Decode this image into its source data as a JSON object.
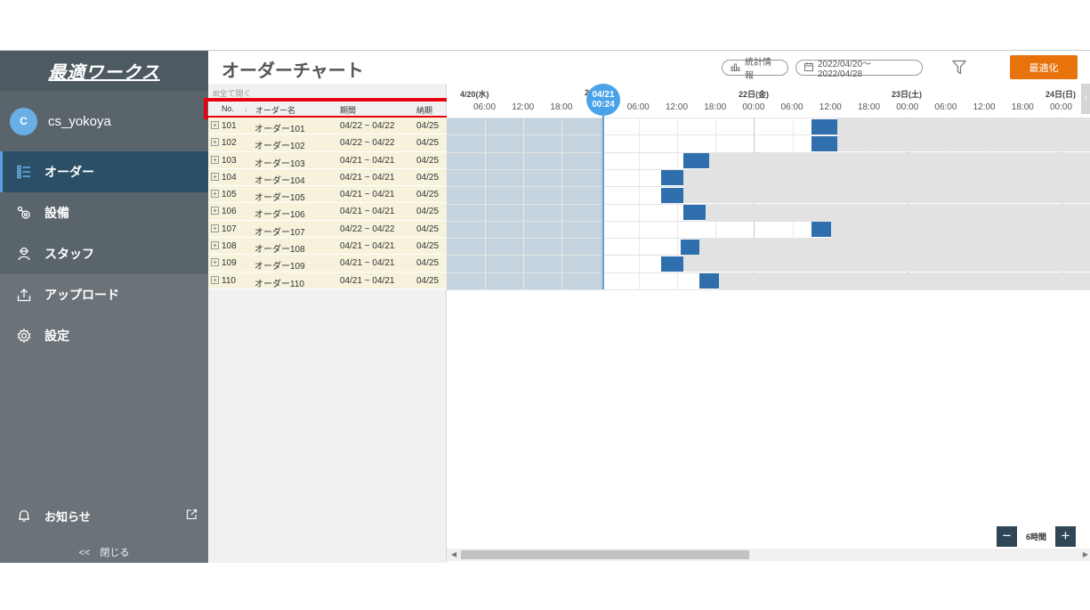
{
  "sidebar": {
    "logo": "最適ワークス",
    "user": {
      "initial": "C",
      "name": "cs_yokoya"
    },
    "nav": [
      {
        "icon": "list-icon",
        "label": "オーダー"
      },
      {
        "icon": "equipment-gear-icon",
        "label": "設備"
      },
      {
        "icon": "staff-person-icon",
        "label": "スタッフ"
      },
      {
        "icon": "upload-icon",
        "label": "アップロード"
      },
      {
        "icon": "settings-gear-icon",
        "label": "設定"
      }
    ],
    "notice": "お知らせ",
    "collapse": "<<　閉じる"
  },
  "header": {
    "title": "オーダーチャート",
    "stats_label": "統計情報",
    "date_range": "2022/04/20〜2022/04/28",
    "optimize_label": "最適化"
  },
  "orders": {
    "expand_all": "全て開く",
    "columns": {
      "no": "No.",
      "sort_arrow": "↓",
      "name": "オーダー名",
      "period": "期間",
      "due": "納期"
    },
    "rows": [
      {
        "no": "101",
        "name": "オーダー101",
        "period": "04/22 ~ 04/22",
        "due": "04/25"
      },
      {
        "no": "102",
        "name": "オーダー102",
        "period": "04/22 ~ 04/22",
        "due": "04/25"
      },
      {
        "no": "103",
        "name": "オーダー103",
        "period": "04/21 ~ 04/21",
        "due": "04/25"
      },
      {
        "no": "104",
        "name": "オーダー104",
        "period": "04/21 ~ 04/21",
        "due": "04/25"
      },
      {
        "no": "105",
        "name": "オーダー105",
        "period": "04/21 ~ 04/21",
        "due": "04/25"
      },
      {
        "no": "106",
        "name": "オーダー106",
        "period": "04/21 ~ 04/21",
        "due": "04/25"
      },
      {
        "no": "107",
        "name": "オーダー107",
        "period": "04/22 ~ 04/22",
        "due": "04/25"
      },
      {
        "no": "108",
        "name": "オーダー108",
        "period": "04/21 ~ 04/21",
        "due": "04/25"
      },
      {
        "no": "109",
        "name": "オーダー109",
        "period": "04/21 ~ 04/21",
        "due": "04/25"
      },
      {
        "no": "110",
        "name": "オーダー110",
        "period": "04/21 ~ 04/21",
        "due": "04/25"
      }
    ]
  },
  "gantt": {
    "days": [
      "4/20(水)",
      "2",
      "22日(金)",
      "23日(土)",
      "24日(日)"
    ],
    "hours": [
      "06:00",
      "12:00",
      "18:00",
      "00:00",
      "06:00",
      "12:00",
      "18:00",
      "00:00",
      "06:00",
      "12:00",
      "18:00",
      "00:00",
      "06:00",
      "12:00",
      "18:00",
      "00:00"
    ],
    "now": {
      "date": "04/21",
      "time": "00:24"
    },
    "zoom_label": "6時間",
    "bars": [
      {
        "order": "101",
        "start": "04/22 09:00",
        "hours": 4
      },
      {
        "order": "102",
        "start": "04/22 09:00",
        "hours": 4
      },
      {
        "order": "103",
        "start": "04/21 13:00",
        "hours": 4
      },
      {
        "order": "104",
        "start": "04/21 09:30",
        "hours": 3.5
      },
      {
        "order": "105",
        "start": "04/21 09:30",
        "hours": 3.5
      },
      {
        "order": "106",
        "start": "04/21 13:00",
        "hours": 3.5
      },
      {
        "order": "107",
        "start": "04/22 09:00",
        "hours": 3
      },
      {
        "order": "108",
        "start": "04/21 12:30",
        "hours": 3
      },
      {
        "order": "109",
        "start": "04/21 09:30",
        "hours": 3.5
      },
      {
        "order": "110",
        "start": "04/21 15:30",
        "hours": 3
      }
    ]
  },
  "colors": {
    "accent": "#e8730c",
    "bar": "#2f6fad",
    "active_nav": "#2b4f66",
    "highlight": "#e8000e"
  }
}
